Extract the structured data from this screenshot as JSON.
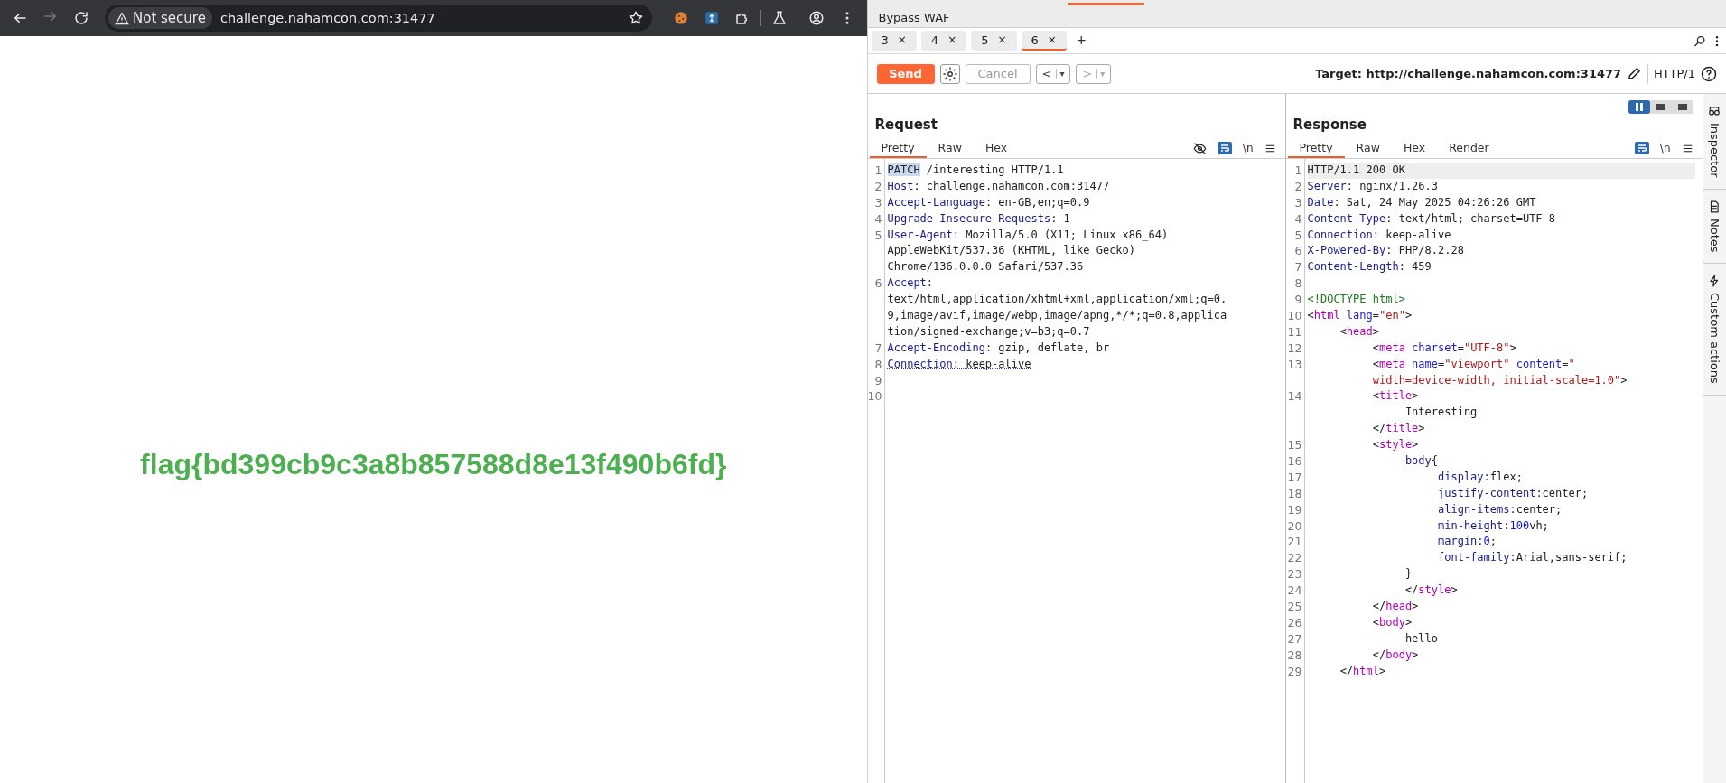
{
  "browser": {
    "forward_disabled": true,
    "security_label": "Not secure",
    "url": "challenge.nahamcon.com:31477"
  },
  "page": {
    "flag": "flag{bd399cb9c3a8b857588d8e13f490b6fd}"
  },
  "burp": {
    "group_label": "Bypass WAF",
    "tabs": [
      {
        "label": "3",
        "close": "×",
        "selected": false
      },
      {
        "label": "4",
        "close": "×",
        "selected": false
      },
      {
        "label": "5",
        "close": "×",
        "selected": false
      },
      {
        "label": "6",
        "close": "×",
        "selected": true
      }
    ],
    "new_tab": "+",
    "toolbar": {
      "send": "Send",
      "cancel": "Cancel",
      "cancel_disabled": true,
      "back": "<",
      "back_menu": "▾",
      "forward": ">",
      "forward_menu": "▾",
      "target": "Target: http://challenge.nahamcon.com:31477",
      "protocol": "HTTP/1"
    },
    "layout_modes": [
      {
        "kind": "columns",
        "selected": true
      },
      {
        "kind": "rows",
        "selected": false
      },
      {
        "kind": "tabs",
        "selected": false
      }
    ],
    "request": {
      "title": "Request",
      "newline_toggle": "\\n",
      "tabs": [
        {
          "label": "Pretty",
          "selected": true
        },
        {
          "label": "Raw",
          "selected": false
        },
        {
          "label": "Hex",
          "selected": false
        }
      ],
      "lines": [
        {
          "number": "1",
          "parts": [
            {
              "kind": "sel",
              "text": "PATCH"
            },
            {
              "kind": "plain",
              "text": " /interesting HTTP/1.1"
            }
          ]
        },
        {
          "number": "2",
          "parts": [
            {
              "kind": "key",
              "text": "Host"
            },
            {
              "kind": "plain",
              "text": ": challenge.nahamcon.com:31477"
            }
          ]
        },
        {
          "number": "3",
          "parts": [
            {
              "kind": "key",
              "text": "Accept-Language"
            },
            {
              "kind": "plain",
              "text": ": en-GB,en;q=0.9"
            }
          ]
        },
        {
          "number": "4",
          "parts": [
            {
              "kind": "key",
              "text": "Upgrade-Insecure-Requests"
            },
            {
              "kind": "plain",
              "text": ": 1"
            }
          ]
        },
        {
          "number": "5",
          "parts": [
            {
              "kind": "key",
              "text": "User-Agent"
            },
            {
              "kind": "plain",
              "text": ": Mozilla/5.0 (X11; Linux x86_64)"
            }
          ]
        },
        {
          "parts": [
            {
              "kind": "plain",
              "text": "AppleWebKit/537.36 (KHTML, like Gecko)"
            }
          ]
        },
        {
          "parts": [
            {
              "kind": "plain",
              "text": "Chrome/136.0.0.0 Safari/537.36"
            }
          ]
        },
        {
          "number": "6",
          "parts": [
            {
              "kind": "key",
              "text": "Accept"
            },
            {
              "kind": "plain",
              "text": ":"
            }
          ]
        },
        {
          "parts": [
            {
              "kind": "plain",
              "text": "text/html,application/xhtml+xml,application/xml;q=0."
            }
          ]
        },
        {
          "parts": [
            {
              "kind": "plain",
              "text": "9,image/avif,image/webp,image/apng,*/*;q=0.8,applica"
            }
          ]
        },
        {
          "parts": [
            {
              "kind": "plain",
              "text": "tion/signed-exchange;v=b3;q=0.7"
            }
          ]
        },
        {
          "number": "7",
          "parts": [
            {
              "kind": "key",
              "text": "Accept-Encoding"
            },
            {
              "kind": "plain",
              "text": ": gzip, deflate, br"
            }
          ]
        },
        {
          "number": "8",
          "parts": [
            {
              "kind": "flagkey",
              "text": "Connection"
            },
            {
              "kind": "flagplain",
              "text": ": keep-alive"
            }
          ]
        },
        {
          "number": "9"
        },
        {
          "number": "10"
        }
      ]
    },
    "response": {
      "title": "Response",
      "newline_toggle": "\\n",
      "tabs": [
        {
          "label": "Pretty",
          "selected": true
        },
        {
          "label": "Raw",
          "selected": false
        },
        {
          "label": "Hex",
          "selected": false
        },
        {
          "label": "Render",
          "selected": false
        }
      ],
      "lines": [
        {
          "number": "1",
          "current": true,
          "parts": [
            {
              "kind": "plain",
              "text": "HTTP/1.1 200 OK"
            }
          ]
        },
        {
          "number": "2",
          "current": false,
          "parts": [
            {
              "kind": "key",
              "text": "Server"
            },
            {
              "kind": "plain",
              "text": ": nginx/1.26.3"
            }
          ]
        },
        {
          "number": "3",
          "current": false,
          "parts": [
            {
              "kind": "key",
              "text": "Date"
            },
            {
              "kind": "plain",
              "text": ": Sat, 24 May 2025 04:26:26 GMT"
            }
          ]
        },
        {
          "number": "4",
          "current": false,
          "parts": [
            {
              "kind": "key",
              "text": "Content-Type"
            },
            {
              "kind": "plain",
              "text": ": text/html; charset=UTF-8"
            }
          ]
        },
        {
          "number": "5",
          "current": false,
          "parts": [
            {
              "kind": "key",
              "text": "Connection"
            },
            {
              "kind": "plain",
              "text": ": keep-alive"
            }
          ]
        },
        {
          "number": "6",
          "current": false,
          "parts": [
            {
              "kind": "key",
              "text": "X-Powered-By"
            },
            {
              "kind": "plain",
              "text": ": PHP/8.2.28"
            }
          ]
        },
        {
          "number": "7",
          "current": false,
          "parts": [
            {
              "kind": "key",
              "text": "Content-Length"
            },
            {
              "kind": "plain",
              "text": ": 459"
            }
          ]
        },
        {
          "number": "8"
        },
        {
          "number": "9",
          "current": false,
          "parts": [
            {
              "kind": "doctype",
              "text": "<!DOCTYPE html>"
            }
          ]
        },
        {
          "number": "10",
          "current": false,
          "parts": [
            {
              "kind": "plain",
              "text": "<"
            },
            {
              "kind": "tag",
              "text": "html"
            },
            {
              "kind": "attr",
              "text": " lang"
            },
            {
              "kind": "plain",
              "text": "="
            },
            {
              "kind": "str",
              "text": "\"en\""
            },
            {
              "kind": "plain",
              "text": ">"
            }
          ]
        },
        {
          "number": "11",
          "current": false,
          "parts": [
            {
              "kind": "plain",
              "text": "\t<"
            },
            {
              "kind": "tag",
              "text": "head"
            },
            {
              "kind": "plain",
              "text": ">"
            }
          ]
        },
        {
          "number": "12",
          "current": false,
          "parts": [
            {
              "kind": "plain",
              "text": "\t\t<"
            },
            {
              "kind": "tag",
              "text": "meta"
            },
            {
              "kind": "attr",
              "text": " charset"
            },
            {
              "kind": "plain",
              "text": "="
            },
            {
              "kind": "str",
              "text": "\"UTF-8\""
            },
            {
              "kind": "plain",
              "text": ">"
            }
          ]
        },
        {
          "number": "13",
          "current": false,
          "parts": [
            {
              "kind": "plain",
              "text": "\t\t<"
            },
            {
              "kind": "tag",
              "text": "meta"
            },
            {
              "kind": "attr",
              "text": " name"
            },
            {
              "kind": "plain",
              "text": "="
            },
            {
              "kind": "str",
              "text": "\"viewport\""
            },
            {
              "kind": "attr",
              "text": " content"
            },
            {
              "kind": "plain",
              "text": "="
            },
            {
              "kind": "str",
              "text": "\""
            }
          ]
        },
        {
          "current": false,
          "parts": [
            {
              "kind": "str",
              "text": "\t\twidth=device-width, initial-scale=1.0\""
            },
            {
              "kind": "plain",
              "text": ">"
            }
          ]
        },
        {
          "number": "14",
          "current": false,
          "parts": [
            {
              "kind": "plain",
              "text": "\t\t<"
            },
            {
              "kind": "tag",
              "text": "title"
            },
            {
              "kind": "plain",
              "text": ">"
            }
          ]
        },
        {
          "current": false,
          "parts": [
            {
              "kind": "plain",
              "text": "\t\t\tInteresting"
            }
          ]
        },
        {
          "current": false,
          "parts": [
            {
              "kind": "plain",
              "text": "\t\t</"
            },
            {
              "kind": "tag",
              "text": "title"
            },
            {
              "kind": "plain",
              "text": ">"
            }
          ]
        },
        {
          "number": "15",
          "current": false,
          "parts": [
            {
              "kind": "plain",
              "text": "\t\t<"
            },
            {
              "kind": "tag",
              "text": "style"
            },
            {
              "kind": "plain",
              "text": ">"
            }
          ]
        },
        {
          "number": "16",
          "current": false,
          "parts": [
            {
              "kind": "key",
              "text": "\t\t\tbody"
            },
            {
              "kind": "plain",
              "text": "{"
            }
          ]
        },
        {
          "number": "17",
          "current": false,
          "parts": [
            {
              "kind": "key",
              "text": "\t\t\t\tdisplay"
            },
            {
              "kind": "plain",
              "text": ":flex;"
            }
          ]
        },
        {
          "number": "18",
          "current": false,
          "parts": [
            {
              "kind": "key",
              "text": "\t\t\t\tjustify-content"
            },
            {
              "kind": "plain",
              "text": ":center;"
            }
          ]
        },
        {
          "number": "19",
          "current": false,
          "parts": [
            {
              "kind": "key",
              "text": "\t\t\t\talign-items"
            },
            {
              "kind": "plain",
              "text": ":center;"
            }
          ]
        },
        {
          "number": "20",
          "current": false,
          "parts": [
            {
              "kind": "key",
              "text": "\t\t\t\tmin-height"
            },
            {
              "kind": "plain",
              "text": ":"
            },
            {
              "kind": "num",
              "text": "100"
            },
            {
              "kind": "plain",
              "text": "vh;"
            }
          ]
        },
        {
          "number": "21",
          "current": false,
          "parts": [
            {
              "kind": "key",
              "text": "\t\t\t\tmargin"
            },
            {
              "kind": "plain",
              "text": ":"
            },
            {
              "kind": "num",
              "text": "0"
            },
            {
              "kind": "plain",
              "text": ";"
            }
          ]
        },
        {
          "number": "22",
          "current": false,
          "parts": [
            {
              "kind": "key",
              "text": "\t\t\t\tfont-family"
            },
            {
              "kind": "plain",
              "text": ":Arial,sans-serif;"
            }
          ]
        },
        {
          "number": "23",
          "current": false,
          "parts": [
            {
              "kind": "plain",
              "text": "\t\t\t}"
            }
          ]
        },
        {
          "number": "24",
          "current": false,
          "parts": [
            {
              "kind": "plain",
              "text": "\t\t\t</"
            },
            {
              "kind": "tag",
              "text": "style"
            },
            {
              "kind": "plain",
              "text": ">"
            }
          ]
        },
        {
          "number": "25",
          "current": false,
          "parts": [
            {
              "kind": "plain",
              "text": "\t\t</"
            },
            {
              "kind": "tag",
              "text": "head"
            },
            {
              "kind": "plain",
              "text": ">"
            }
          ]
        },
        {
          "number": "26",
          "current": false,
          "parts": [
            {
              "kind": "plain",
              "text": "\t\t<"
            },
            {
              "kind": "tag",
              "text": "body"
            },
            {
              "kind": "plain",
              "text": ">"
            }
          ]
        },
        {
          "number": "27",
          "current": false,
          "parts": [
            {
              "kind": "plain",
              "text": "\t\t\thello"
            }
          ]
        },
        {
          "number": "28",
          "current": false,
          "parts": [
            {
              "kind": "plain",
              "text": "\t\t</"
            },
            {
              "kind": "tag",
              "text": "body"
            },
            {
              "kind": "plain",
              "text": ">"
            }
          ]
        },
        {
          "number": "29",
          "current": false,
          "parts": [
            {
              "kind": "plain",
              "text": "\t</"
            },
            {
              "kind": "tag",
              "text": "html"
            },
            {
              "kind": "plain",
              "text": ">"
            }
          ]
        }
      ]
    },
    "side_panel": [
      {
        "kind": "inspector",
        "label": "Inspector"
      },
      {
        "kind": "notes",
        "label": "Notes"
      },
      {
        "kind": "actions",
        "label": "Custom actions"
      }
    ]
  }
}
